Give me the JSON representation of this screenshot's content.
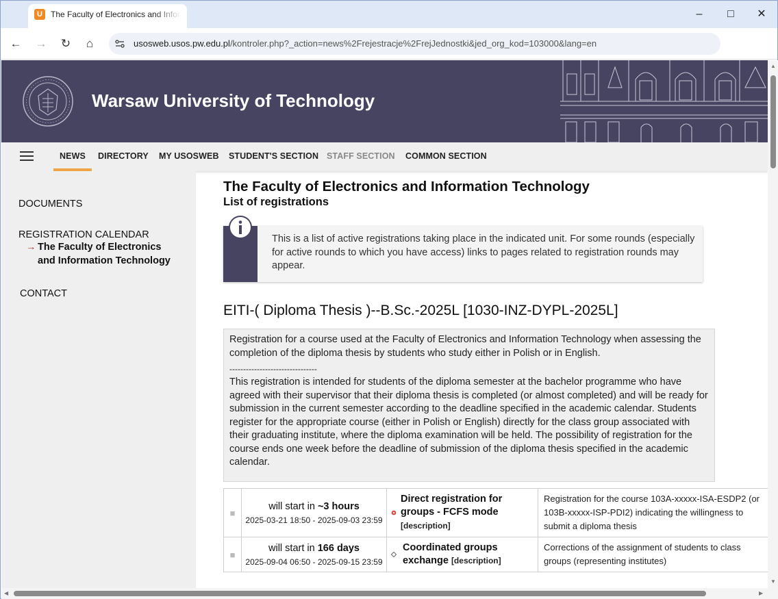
{
  "browser": {
    "tab_title": "The Faculty of Electronics and Information Technology",
    "favicon_letter": "U",
    "url_host": "usosweb.usos.pw.edu.pl",
    "url_path": "/kontroler.php?_action=news%2Frejestracje%2FrejJednostki&jed_org_kod=103000&lang=en"
  },
  "banner": {
    "title": "Warsaw University of Technology"
  },
  "menu": {
    "items": [
      "NEWS",
      "DIRECTORY",
      "MY USOSWEB",
      "STUDENT'S SECTION",
      "STAFF SECTION",
      "COMMON SECTION"
    ],
    "active": "NEWS",
    "disabled": "STAFF SECTION"
  },
  "sidebar": {
    "documents": "DOCUMENTS",
    "registration_calendar": "REGISTRATION CALENDAR",
    "current_unit": "The Faculty of Electronics and Information Technology",
    "contact": "CONTACT"
  },
  "main": {
    "title": "The Faculty of Electronics and Information Technology",
    "subtitle": "List of registrations",
    "info": "This is a list of active registrations taking place in the indicated unit. For some rounds (especially for active rounds to which you have access) links to pages related to registration rounds may appear.",
    "registration_title": "EITI-( Diploma Thesis )--B.Sc.-2025L [1030-INZ-DYPL-2025L]",
    "desc_p1": "Registration for a course used at the Faculty of Electronics and Information Technology when assessing the completion of the diploma thesis by students who study either in Polish or in English.",
    "desc_sep": "--------------------------------",
    "desc_p2": "This registration is intended for students of the diploma semester at the bachelor programme who have agreed with their supervisor that their diploma thesis is completed (or almost completed) and will be ready for submission in the current semester according to the deadline specified in the academic calendar. Students register for the appropriate course (either in Polish or English) directly for the class group associated with their graduating institute, where the diploma examination will be held. The possibility of registration for the course ends one week before the deadline of submission of the diploma thesis specified in the academic calendar."
  },
  "rounds": [
    {
      "when_prefix": "will start in",
      "when_value": "~3 hours",
      "dates": "2025-03-21 18:50 - 2025-09-03 23:59",
      "name": "Direct registration for groups - FCFS mode",
      "desc_link": "[description]",
      "marker": "red-dot",
      "description": "Registration for the course 103A-xxxxx-ISA-ESDP2 (or 103B-xxxxx-ISP-PDI2) indicating the willingness to submit a diploma thesis"
    },
    {
      "when_prefix": "will start in",
      "when_value": "166 days",
      "dates": "2025-09-04 06:50 - 2025-09-15 23:59",
      "name": "Coordinated groups exchange",
      "desc_link": "[description]",
      "marker": "diamond",
      "description": "Corrections of the assignment of students to class groups (representing institutes)"
    }
  ]
}
